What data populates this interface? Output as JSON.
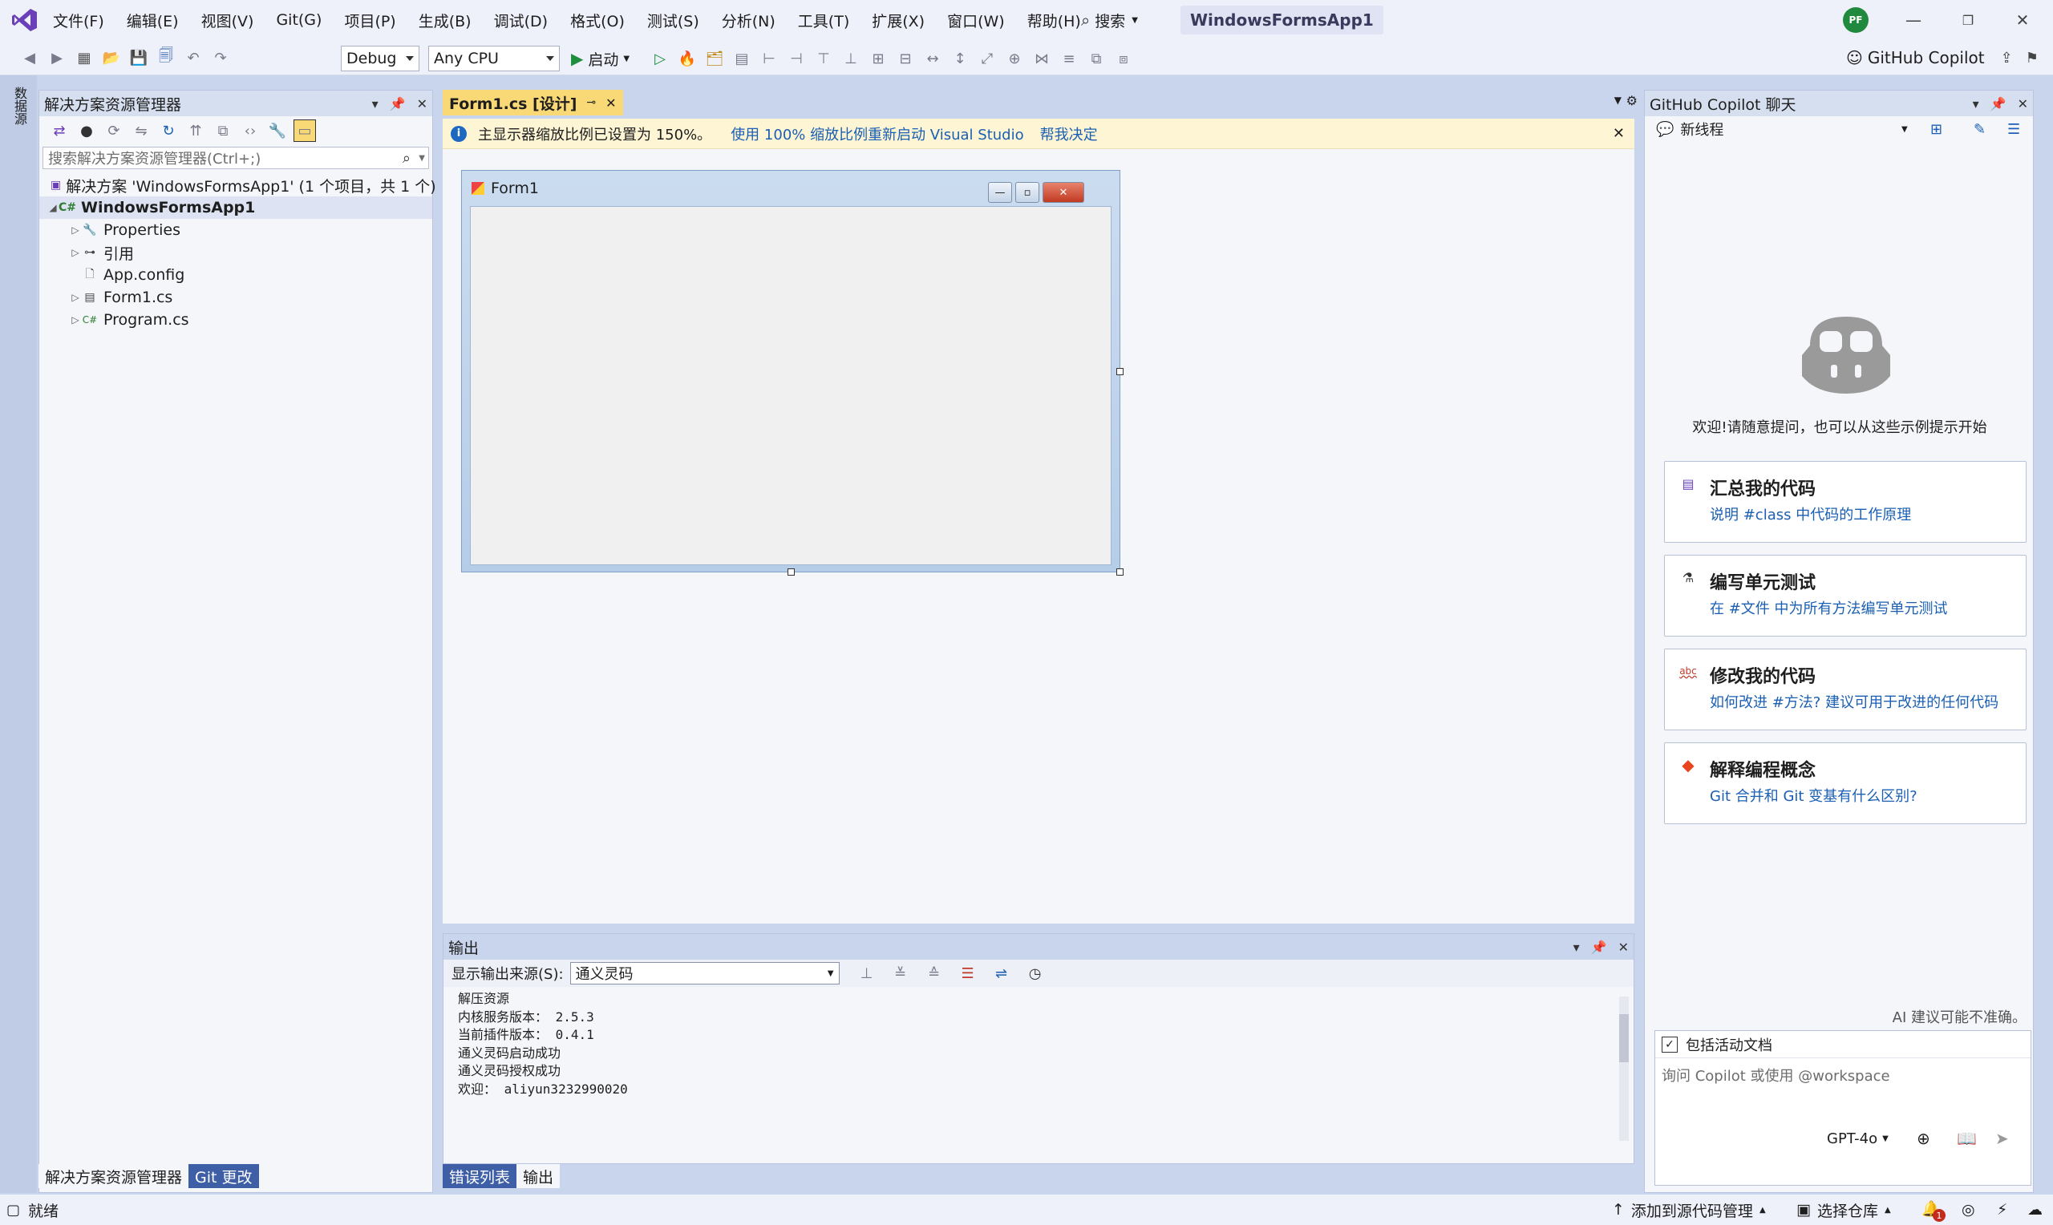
{
  "menu": [
    "文件(F)",
    "编辑(E)",
    "视图(V)",
    "Git(G)",
    "项目(P)",
    "生成(B)",
    "调试(D)",
    "格式(O)",
    "测试(S)",
    "分析(N)",
    "工具(T)",
    "扩展(X)",
    "窗口(W)",
    "帮助(H)"
  ],
  "search_label": "搜索",
  "project_title": "WindowsFormsApp1",
  "avatar_initials": "PF",
  "toolbar": {
    "config": "Debug",
    "platform": "Any CPU",
    "start_label": "启动",
    "copilot_label": "GitHub Copilot"
  },
  "left_strip_tab": "数据源",
  "solution_explorer": {
    "title": "解决方案资源管理器",
    "search_placeholder": "搜索解决方案资源管理器(Ctrl+;)",
    "solution_label": "解决方案 'WindowsFormsApp1' (1 个项目，共 1 个)",
    "project": "WindowsFormsApp1",
    "items": [
      "Properties",
      "引用",
      "App.config",
      "Form1.cs",
      "Program.cs"
    ],
    "tab_active": "解决方案资源管理器",
    "tab_git": "Git 更改"
  },
  "document": {
    "tab_label": "Form1.cs [设计]",
    "info_text": "主显示器缩放比例已设置为 150%。",
    "info_link1": "使用 100% 缩放比例重新启动 Visual Studio",
    "info_link2": "帮我决定",
    "form_title": "Form1"
  },
  "output": {
    "title": "输出",
    "source_label": "显示输出来源(S):",
    "source_value": "通义灵码",
    "lines": "解压资源\n内核服务版本： 2.5.3\n当前插件版本： 0.4.1\n通义灵码启动成功\n通义灵码授权成功\n欢迎： aliyun3232990020",
    "tab_errors": "错误列表",
    "tab_output": "输出"
  },
  "copilot": {
    "title": "GitHub Copilot 聊天",
    "thread_label": "新线程",
    "welcome": "欢迎!请随意提问，也可以从这些示例提示开始",
    "cards": [
      {
        "title": "汇总我的代码",
        "sub": "说明 #class 中代码的工作原理",
        "icon": "summary-icon"
      },
      {
        "title": "编写单元测试",
        "sub": "在 #文件 中为所有方法编写单元测试",
        "icon": "flask-icon"
      },
      {
        "title": "修改我的代码",
        "sub": "如何改进 #方法? 建议可用于改进的任何代码",
        "icon": "abc-icon"
      },
      {
        "title": "解释编程概念",
        "sub": "Git 合并和 Git 变基有什么区别?",
        "icon": "git-icon"
      }
    ],
    "disclaimer": "AI 建议可能不准确。",
    "include_doc_label": "包括活动文档",
    "input_placeholder": "询问 Copilot 或使用 @workspace",
    "model": "GPT-4o"
  },
  "status": {
    "ready": "就绪",
    "add_source": "添加到源代码管理",
    "select_repo": "选择仓库",
    "notif_count": "1"
  }
}
